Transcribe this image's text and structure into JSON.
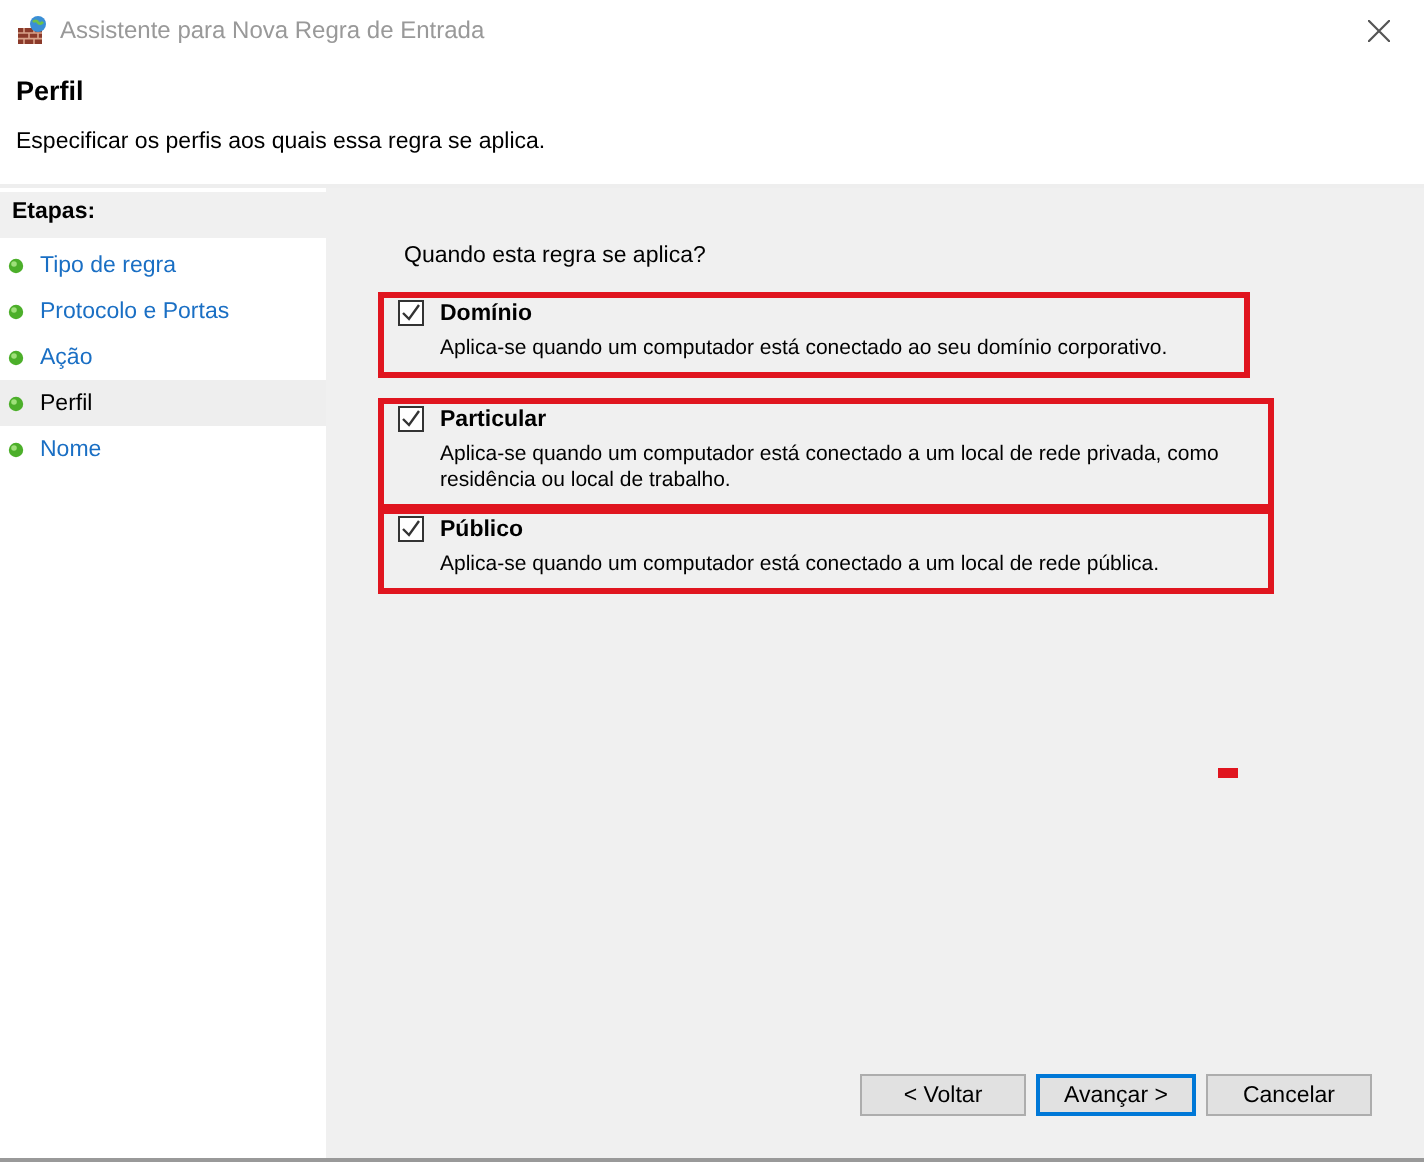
{
  "window": {
    "title": "Assistente para Nova Regra de Entrada"
  },
  "header": {
    "title": "Perfil",
    "subtitle": "Especificar os perfis aos quais essa regra se aplica."
  },
  "sidebar": {
    "heading": "Etapas:",
    "items": [
      {
        "label": "Tipo de regra",
        "selected": false
      },
      {
        "label": "Protocolo e Portas",
        "selected": false
      },
      {
        "label": "Ação",
        "selected": false
      },
      {
        "label": "Perfil",
        "selected": true
      },
      {
        "label": "Nome",
        "selected": false
      }
    ]
  },
  "question": "Quando esta regra se aplica?",
  "options": [
    {
      "label": "Domínio",
      "description": "Aplica-se quando um computador está conectado ao seu domínio corporativo.",
      "checked": true,
      "highlighted": true
    },
    {
      "label": "Particular",
      "description": "Aplica-se quando um computador está conectado a um local de rede privada, como residência ou local de trabalho.",
      "checked": true,
      "highlighted": true
    },
    {
      "label": "Público",
      "description": "Aplica-se quando um computador está conectado a um local de rede pública.",
      "checked": true,
      "highlighted": true
    }
  ],
  "buttons": [
    {
      "label": "< Voltar",
      "default": false
    },
    {
      "label": "Avançar >",
      "default": true
    },
    {
      "label": "Cancelar",
      "default": false
    }
  ]
}
